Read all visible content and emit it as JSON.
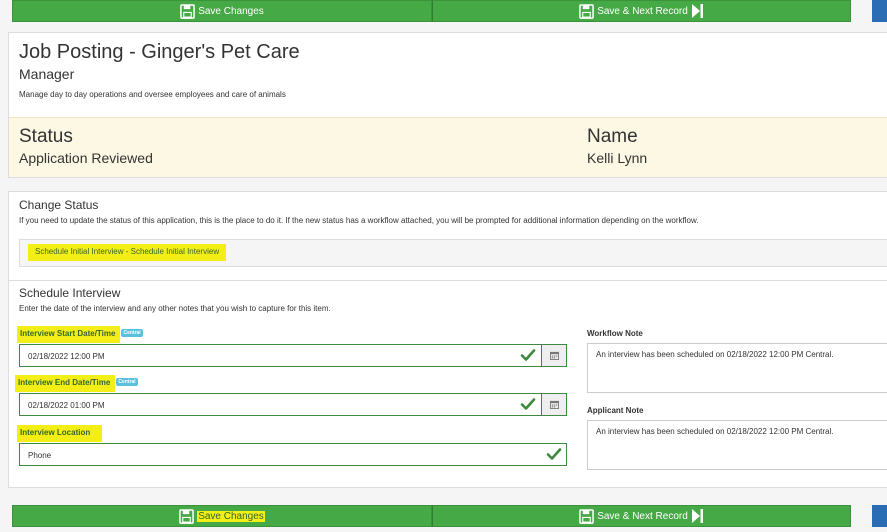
{
  "toolbar": {
    "save_label": "Save Changes",
    "save_next_label": "Save & Next Record"
  },
  "posting": {
    "title": "Job Posting - Ginger's Pet Care",
    "position": "Manager",
    "description": "Manage day to day operations and oversee employees and care of animals"
  },
  "summary": {
    "status_label": "Status",
    "status_value": "Application Reviewed",
    "name_label": "Name",
    "name_value": "Kelli Lynn"
  },
  "change_status": {
    "title": "Change Status",
    "description": "If you need to update the status of this application, this is the place to do it. If the new status has a workflow attached, you will be prompted for additional information depending on the workflow.",
    "selected": "Schedule Initial Interview - Schedule Initial Interview"
  },
  "schedule": {
    "title": "Schedule Interview",
    "description": "Enter the date of the interview and any other notes that you wish to capture for this item.",
    "start_label": "Interview Start Date/Time",
    "start_tz": "Central",
    "start_value": "02/18/2022 12:00 PM",
    "end_label": "Interview End Date/Time",
    "end_tz": "Central",
    "end_value": "02/18/2022 01:00 PM",
    "location_label": "Interview Location",
    "location_value": "Phone",
    "workflow_note_label": "Workflow Note",
    "workflow_note_value": "An interview has been scheduled on 02/18/2022 12:00 PM Central.",
    "applicant_note_label": "Applicant Note",
    "applicant_note_value": "An interview has been scheduled on 02/18/2022 12:00 PM Central."
  },
  "colors": {
    "green_button": "#45a945",
    "highlight": "#f3ef16",
    "status_band": "#fcf8e3",
    "valid_border": "#3c8a3c",
    "tz_badge": "#5bc0de",
    "blue_button": "#2a6db5"
  }
}
